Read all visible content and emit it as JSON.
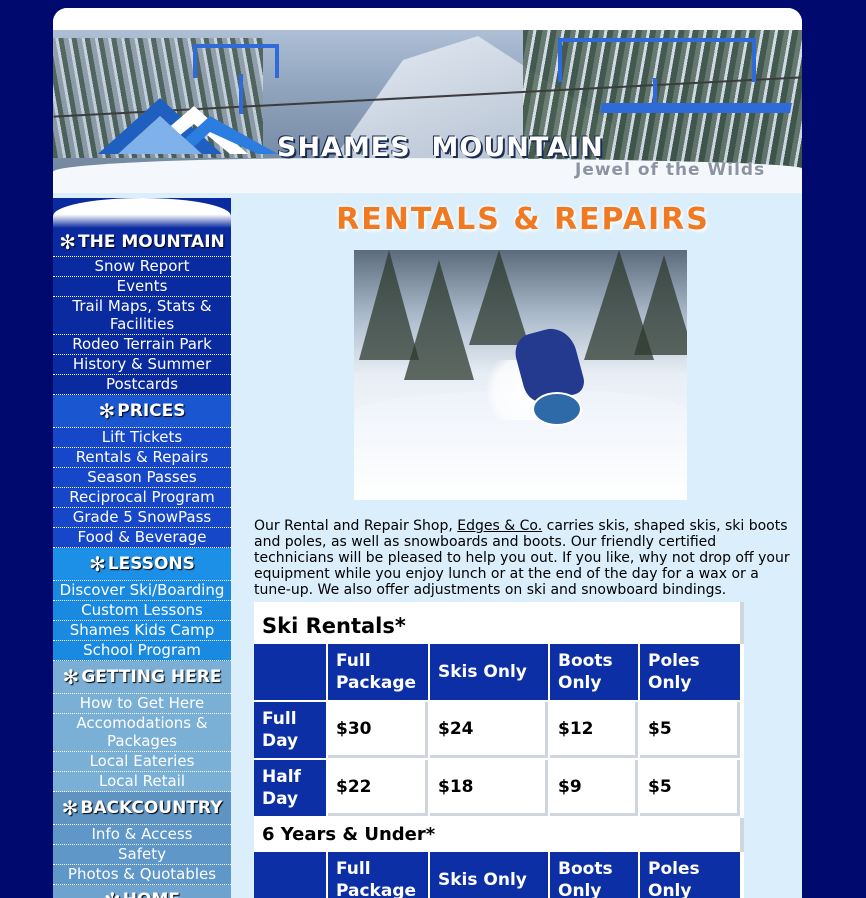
{
  "header": {
    "title": "SHAMES  MOUNTAIN",
    "tagline": "Jewel of the Wilds"
  },
  "sidebar": {
    "sections": [
      {
        "heading": "THE MOUNTAIN",
        "items": [
          "Snow Report",
          "Events",
          "Trail Maps, Stats & Facilities",
          "Rodeo Terrain Park",
          "History & Summer",
          "Postcards"
        ]
      },
      {
        "heading": "PRICES",
        "items": [
          "Lift Tickets",
          "Rentals & Repairs",
          "Season Passes",
          "Reciprocal Program",
          "Grade 5 SnowPass",
          "Food & Beverage"
        ]
      },
      {
        "heading": "LESSONS",
        "items": [
          "Discover Ski/Boarding",
          "Custom Lessons",
          "Shames Kids Camp",
          "School Program"
        ]
      },
      {
        "heading": "GETTING HERE",
        "items": [
          "How to Get Here",
          "Accomodations & Packages",
          "Local Eateries",
          "Local Retail"
        ]
      },
      {
        "heading": "BACKCOUNTRY",
        "items": [
          "Info & Access",
          "Safety",
          "Photos & Quotables"
        ]
      },
      {
        "heading": "HOME",
        "items": []
      }
    ]
  },
  "main": {
    "title": "RENTALS & REPAIRS",
    "intro_before": "Our Rental and Repair Shop, ",
    "intro_link": "Edges & Co.",
    "intro_after": " carries skis, shaped skis, ski boots and poles, as well as snowboards and boots. Our friendly certified technicians will be pleased to help you out. If you like, why not drop off your equipment while you enjoy lunch or at the end of the day for a wax or a tune-up. We also offer adjustments on ski and snowboard bindings."
  },
  "ski_rentals": {
    "title": "Ski Rentals*",
    "columns": [
      "Full Package",
      "Skis Only",
      "Boots Only",
      "Poles Only"
    ],
    "rows": [
      {
        "label": "Full Day",
        "values": [
          "$30",
          "$24",
          "$12",
          "$5"
        ]
      },
      {
        "label": "Half Day",
        "values": [
          "$22",
          "$18",
          "$9",
          "$5"
        ]
      }
    ]
  },
  "youth_rentals": {
    "title": "6 Years & Under*",
    "columns": [
      "Full Package",
      "Skis Only",
      "Boots Only",
      "Poles Only"
    ]
  },
  "colors": {
    "page_bg": "#000a6e",
    "content_bg": "#dbeefb",
    "accent_orange": "#f07a22",
    "table_header_blue": "#0d2fa5"
  }
}
